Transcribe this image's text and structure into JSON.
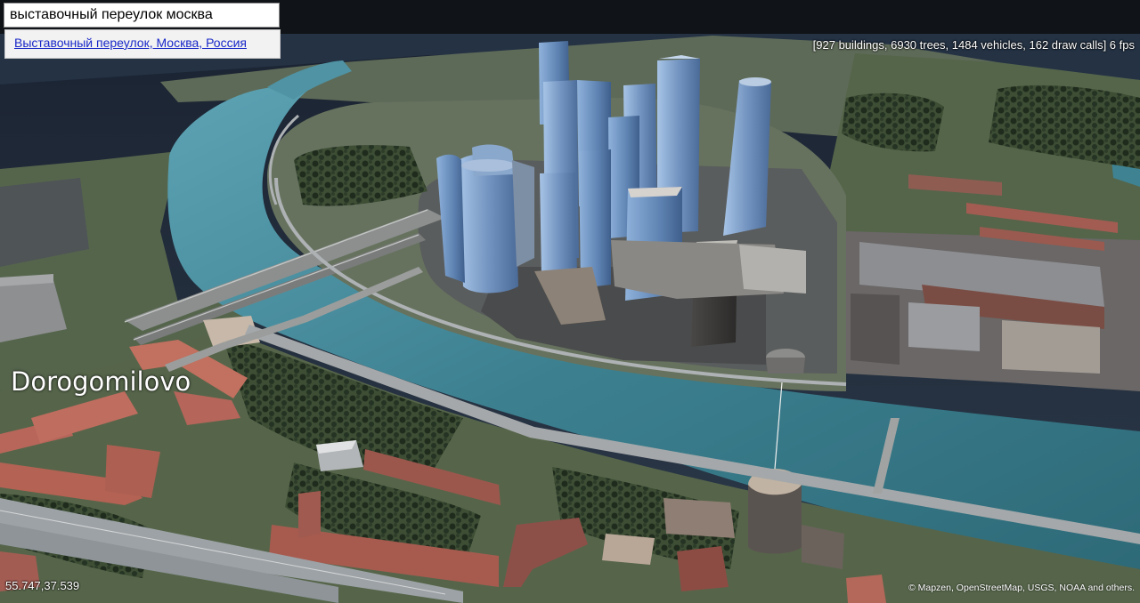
{
  "search": {
    "value": "выставочный переулок москва",
    "results": [
      {
        "label": "Выставочный переулок, Москва, Россия"
      }
    ]
  },
  "stats": {
    "text": "[927 buildings, 6930 trees, 1484 vehicles, 162 draw calls] 6 fps"
  },
  "map": {
    "place_label": "Dorogomilovo",
    "coordinates": "55.747,37.539",
    "attribution": "© Mapzen, OpenStreetMap, USGS, NOAA and others."
  },
  "colors": {
    "river": "#3f7e88",
    "ground": "#5c6b4e",
    "road": "#9ea3a6",
    "tower_glass": "#6f8fb8",
    "brick_roof": "#b8685a",
    "link": "#1a28c8"
  }
}
